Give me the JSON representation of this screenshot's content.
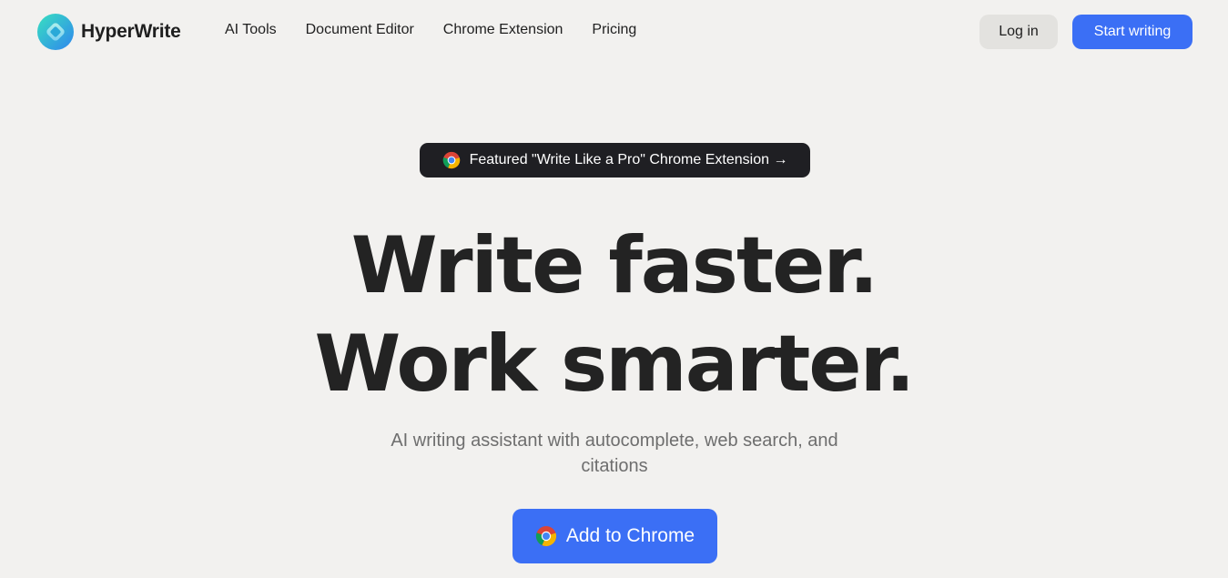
{
  "brand": {
    "name": "HyperWrite",
    "logo_icon": "hyperwrite-logo-icon",
    "logo_colors": [
      "#2bd4b0",
      "#3a8ff0"
    ]
  },
  "nav": {
    "items": [
      {
        "label": "AI Tools"
      },
      {
        "label": "Document Editor"
      },
      {
        "label": "Chrome Extension"
      },
      {
        "label": "Pricing"
      }
    ]
  },
  "header_actions": {
    "login_label": "Log in",
    "start_label": "Start writing"
  },
  "featured": {
    "label": "Featured \"Write Like a Pro\" Chrome Extension →",
    "icon": "chrome-icon"
  },
  "hero": {
    "title_line1": "Write faster.",
    "title_line2": "Work smarter.",
    "subtitle": "AI writing assistant with autocomplete, web search, and citations",
    "cta_label": "Add to Chrome",
    "cta_icon": "chrome-icon"
  },
  "colors": {
    "background": "#f2f1ef",
    "accent": "#3b6ff5",
    "pill_bg": "#1f1f23",
    "login_bg": "#e3e2df"
  }
}
